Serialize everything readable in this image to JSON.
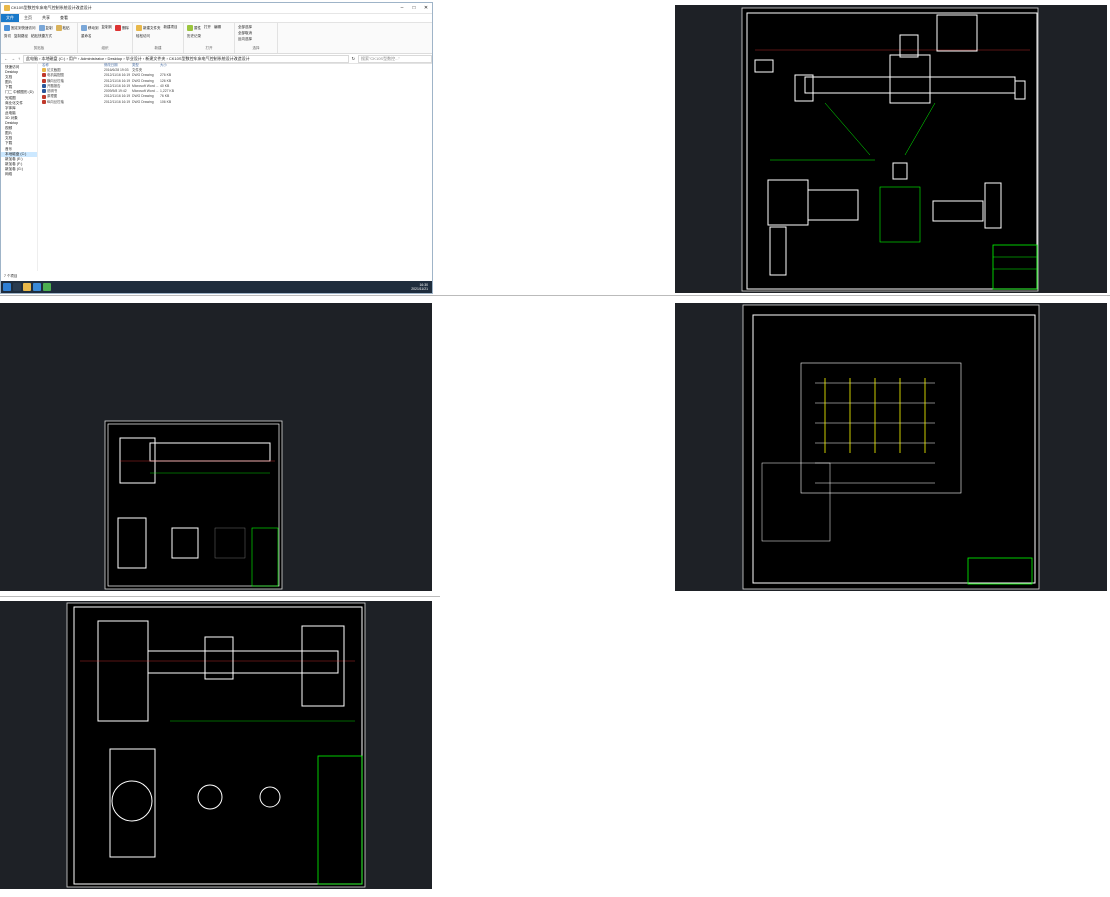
{
  "explorer": {
    "title": "CK10S型数控车床电气控制系统设计改造设计",
    "ribbon_tabs": [
      "文件",
      "主页",
      "共享",
      "查看"
    ],
    "ribbon_groups": [
      {
        "name": "剪贴板",
        "items": [
          "固定到快速访问",
          "复制",
          "粘贴",
          "剪切",
          "复制路径",
          "粘贴快捷方式"
        ]
      },
      {
        "name": "组织",
        "items": [
          "移动到",
          "复制到",
          "删除",
          "重命名"
        ]
      },
      {
        "name": "新建",
        "items": [
          "新建文件夹",
          "新建项目",
          "轻松访问"
        ]
      },
      {
        "name": "打开",
        "items": [
          "属性",
          "打开",
          "编辑",
          "历史记录"
        ]
      },
      {
        "name": "选择",
        "items": [
          "全部选择",
          "全部取消",
          "反向选择"
        ]
      }
    ],
    "address_path": "此电脑 › 本地磁盘 (C:) › 用户 › Administrator › Desktop › 毕业设计 › 新建文件夹 › CK10S型数控车床电气控制系统设计改造设计",
    "search_placeholder": "搜索\"CK10S型数控...\"",
    "nav_items": [
      "快速访问",
      "Desktop",
      "文档",
      "图片",
      "下载",
      "门二 中频图形 (D)",
      "完成图",
      "商业化文件",
      "字体库",
      "此电脑",
      "3D 对象",
      "Desktop",
      "视频",
      "图片",
      "文档",
      "下载",
      "音乐",
      "本地磁盘 (C:)",
      "新加卷 (E:)",
      "新加卷 (F:)",
      "新加卷 (G:)",
      "网络"
    ],
    "nav_selected_index": 17,
    "columns": [
      "名称",
      "修改日期",
      "类型",
      "大小"
    ],
    "files": [
      {
        "name": "论文截图",
        "date": "2016/6/28 19:03",
        "type": "文件夹",
        "size": ""
      },
      {
        "name": "电机装配图",
        "date": "2012/11/16 16:19",
        "type": "DWG Drawing",
        "size": "276 KB"
      },
      {
        "name": "横向丝杠轴",
        "date": "2012/11/16 16:19",
        "type": "DWG Drawing",
        "size": "126 KB"
      },
      {
        "name": "开题报告",
        "date": "2012/11/16 16:19",
        "type": "Microsoft Word ...",
        "size": "40 KB"
      },
      {
        "name": "说明书",
        "date": "2009/5/8 19:42",
        "type": "Microsoft Word ...",
        "size": "1,227 KB"
      },
      {
        "name": "原理图",
        "date": "2012/11/16 16:19",
        "type": "DWG Drawing",
        "size": "76 KB"
      },
      {
        "name": "纵向丝杠轴",
        "date": "2012/11/16 16:19",
        "type": "DWG Drawing",
        "size": "106 KB"
      }
    ],
    "status": "7 个项目",
    "tray_time": "16:30",
    "tray_date": "2021/11/21",
    "colors": {
      "accent": "#1979ca",
      "taskbar": "#1f2d3d",
      "folder": "#e8b84a",
      "dwg": "#c0392b",
      "word": "#2b579a"
    }
  },
  "drawings": {
    "background": "#1e2126",
    "line_colors": [
      "#ffffff",
      "#00ff00",
      "#ffff00",
      "#ff0000",
      "#00ffff"
    ]
  }
}
